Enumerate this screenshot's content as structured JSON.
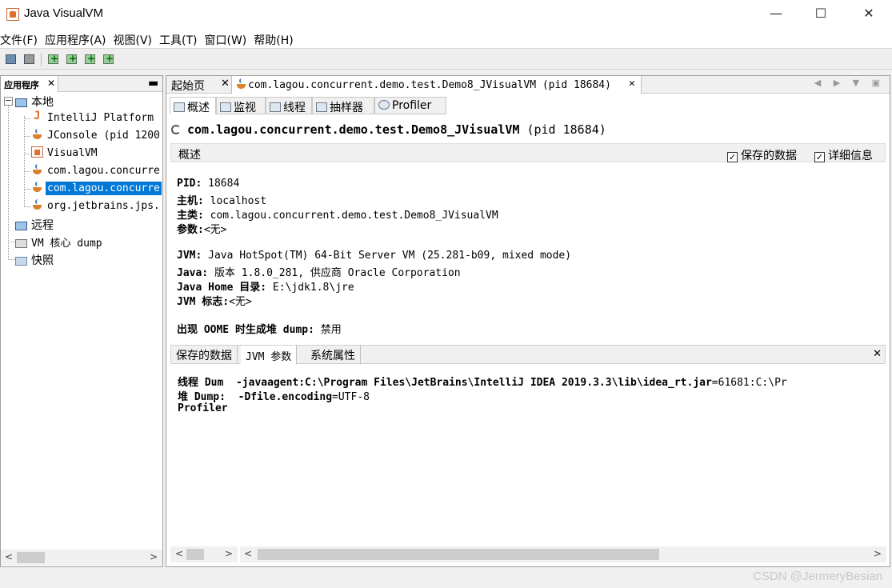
{
  "window": {
    "title": "Java VisualVM",
    "minimize": "—",
    "maximize": "☐",
    "close": "✕"
  },
  "menu": [
    "文件(F)",
    "应用程序(A)",
    "视图(V)",
    "工具(T)",
    "窗口(W)",
    "帮助(H)"
  ],
  "left_panel": {
    "tab_label": "应用程序",
    "tab_close": "✕",
    "minimize": "▬",
    "tree": {
      "local": "本地",
      "intellij": "IntelliJ Platform",
      "jconsole": "JConsole (pid 1200",
      "visualvm": "VisualVM",
      "app1": "com.lagou.concurre",
      "app2": "com.lagou.concurre",
      "jps": "org.jetbrains.jps.",
      "remote": "远程",
      "core_dump": "VM 核心 dump",
      "snapshots": "快照"
    },
    "scroll_left": "<",
    "scroll_right": ">"
  },
  "doc_tabs": {
    "start": "起始页",
    "app": "com.lagou.concurrent.demo.test.Demo8_JVisualVM (pid 18684)",
    "close": "✕",
    "nav": "◀ ▶ ▼ ▣"
  },
  "sub_tabs": [
    "概述",
    "监视",
    "线程",
    "抽样器",
    "Profiler"
  ],
  "header": {
    "app_name": "com.lagou.concurrent.demo.test.Demo8_JVisualVM",
    "pid": "(pid 18684)"
  },
  "overview": {
    "section_title": "概述",
    "saved_data": "保存的数据",
    "details": "详细信息",
    "check_mark": "✓",
    "pid_label": "PID:",
    "pid_value": "18684",
    "host_label": "主机:",
    "host_value": "localhost",
    "main_class_label": "主类:",
    "main_class_value": "com.lagou.concurrent.demo.test.Demo8_JVisualVM",
    "args_label": "参数:",
    "args_value": "<无>",
    "jvm_label": "JVM:",
    "jvm_value": "Java HotSpot(TM) 64-Bit Server VM (25.281-b09, mixed mode)",
    "java_label": "Java:",
    "java_value": "版本 1.8.0_281, 供应商 Oracle Corporation",
    "java_home_label": "Java Home 目录:",
    "java_home_value": "E:\\jdk1.8\\jre",
    "jvm_flags_label": "JVM 标志:",
    "jvm_flags_value": "<无>",
    "oome_label": "出现 OOME 时生成堆 dump:",
    "oome_value": "禁用"
  },
  "bottom_tabs": {
    "saved": "保存的数据",
    "jvm_args": "JVM 参数",
    "sys_props": "系统属性",
    "close": "✕"
  },
  "jvm_args_text": {
    "thread_dump": "线程 Dum",
    "heap_dump": "堆 Dump:",
    "profiler": "Profiler",
    "arg1": "-javaagent:C:\\Program  Files\\JetBrains\\IntelliJ  IDEA  2019.3.3\\lib\\idea_rt.jar",
    "arg1_rest": "=61681:C:\\Pr",
    "arg2": "-Dfile.encoding",
    "arg2_rest": "=UTF-8"
  },
  "scrollbar": {
    "left": "<",
    "right": ">"
  },
  "watermark": "CSDN @JermeryBesian"
}
